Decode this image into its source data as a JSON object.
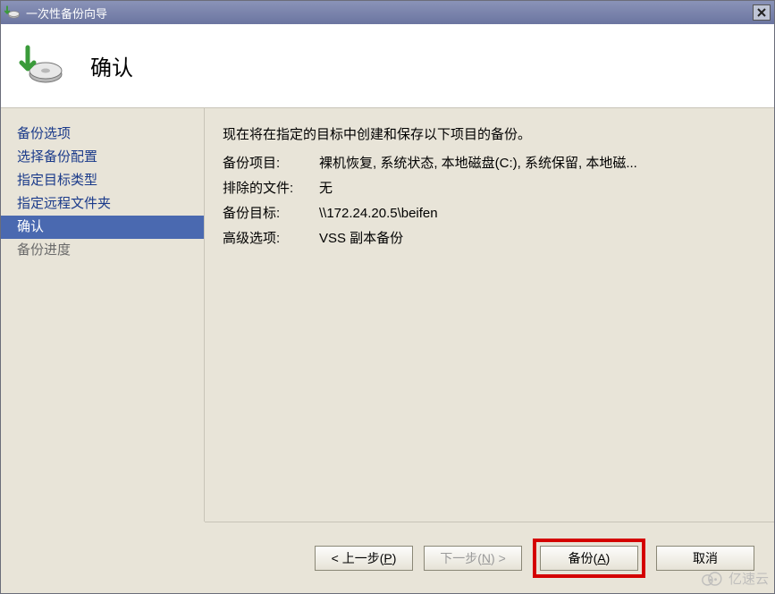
{
  "titlebar": {
    "title": "一次性备份向导"
  },
  "header": {
    "title": "确认"
  },
  "sidebar": {
    "items": [
      {
        "label": "备份选项",
        "state": "normal"
      },
      {
        "label": "选择备份配置",
        "state": "normal"
      },
      {
        "label": "指定目标类型",
        "state": "normal"
      },
      {
        "label": "指定远程文件夹",
        "state": "normal"
      },
      {
        "label": "确认",
        "state": "active"
      },
      {
        "label": "备份进度",
        "state": "disabled"
      }
    ]
  },
  "content": {
    "intro": "现在将在指定的目标中创建和保存以下项目的备份。",
    "rows": [
      {
        "label": "备份项目:",
        "value": "裸机恢复, 系统状态, 本地磁盘(C:), 系统保留, 本地磁..."
      },
      {
        "label": "排除的文件:",
        "value": "无"
      },
      {
        "label": "备份目标:",
        "value": "\\\\172.24.20.5\\beifen"
      },
      {
        "label": "高级选项:",
        "value": "VSS 副本备份"
      }
    ]
  },
  "footer": {
    "prev_prefix": "< 上一步(",
    "prev_key": "P",
    "prev_suffix": ")",
    "next_prefix": "下一步(",
    "next_key": "N",
    "next_suffix": ") >",
    "backup_prefix": "备份(",
    "backup_key": "A",
    "backup_suffix": ")",
    "cancel": "取消"
  },
  "watermark": {
    "text": "亿速云"
  }
}
